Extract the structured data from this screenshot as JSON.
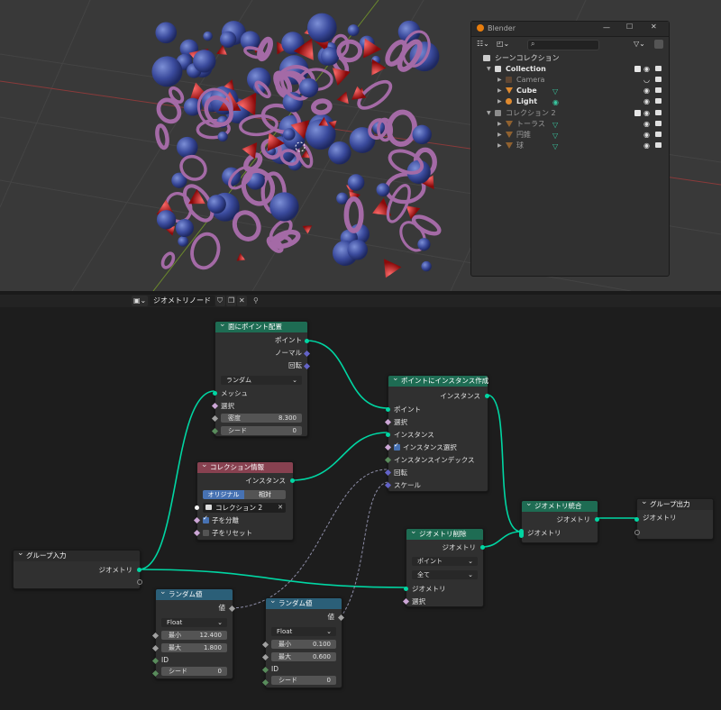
{
  "outliner": {
    "title": "Blender",
    "filter_placeholder": "",
    "scene_collection": "シーンコレクション",
    "rows": [
      {
        "label": "Collection",
        "type": "collection",
        "expanded": true
      },
      {
        "label": "Camera",
        "type": "camera",
        "dim": true
      },
      {
        "label": "Cube",
        "type": "mesh"
      },
      {
        "label": "Light",
        "type": "light"
      },
      {
        "label": "コレクション 2",
        "type": "collection",
        "expanded": true,
        "dim": true
      },
      {
        "label": "トーラス",
        "type": "mesh",
        "dim": true
      },
      {
        "label": "円錐",
        "type": "mesh",
        "dim": true
      },
      {
        "label": "球",
        "type": "mesh",
        "dim": true
      }
    ]
  },
  "node_editor": {
    "tree_name": "ジオメトリノード"
  },
  "nodes": {
    "distribute": {
      "title": "面にポイント配置",
      "outputs": [
        "ポイント",
        "ノーマル",
        "回転"
      ],
      "mode": "ランダム",
      "inputs": [
        "メッシュ",
        "選択"
      ],
      "density_label": "密度",
      "density_value": "8.300",
      "seed_label": "シード",
      "seed_value": "0"
    },
    "instance": {
      "title": "ポイントにインスタンス作成",
      "output": "インスタンス",
      "inputs": [
        "ポイント",
        "選択",
        "インスタンス",
        "インスタンス選択",
        "インスタンスインデックス",
        "回転",
        "スケール"
      ]
    },
    "collection_info": {
      "title": "コレクション情報",
      "output": "インスタンス",
      "toggle_a": "オリジナル",
      "toggle_b": "相対",
      "collection": "コレクション 2",
      "separate_children": "子を分離",
      "reset_children": "子をリセット"
    },
    "join": {
      "title": "ジオメトリ統合",
      "output": "ジオメトリ",
      "input": "ジオメトリ"
    },
    "group_output": {
      "title": "グループ出力",
      "input": "ジオメトリ"
    },
    "group_input": {
      "title": "グループ入力",
      "output": "ジオメトリ"
    },
    "delete": {
      "title": "ジオメトリ削除",
      "output": "ジオメトリ",
      "domain": "ポイント",
      "mode": "全て",
      "inputs": [
        "ジオメトリ",
        "選択"
      ]
    },
    "random1": {
      "title": "ランダム値",
      "output": "値",
      "type": "Float",
      "min_label": "最小",
      "min_value": "12.400",
      "max_label": "最大",
      "max_value": "1.800",
      "id_label": "ID",
      "seed_label": "シード",
      "seed_value": "0"
    },
    "random2": {
      "title": "ランダム値",
      "output": "値",
      "type": "Float",
      "min_label": "最小",
      "min_value": "0.100",
      "max_label": "最大",
      "max_value": "0.600",
      "id_label": "ID",
      "seed_label": "シード",
      "seed_value": "0"
    }
  },
  "colors": {
    "geometry_socket": "#00d6a3",
    "geometry_node_header": "#1e6c53",
    "input_node_header": "#874150",
    "utility_node_header": "#2b5f78",
    "selected_accent": "#4772b3"
  }
}
